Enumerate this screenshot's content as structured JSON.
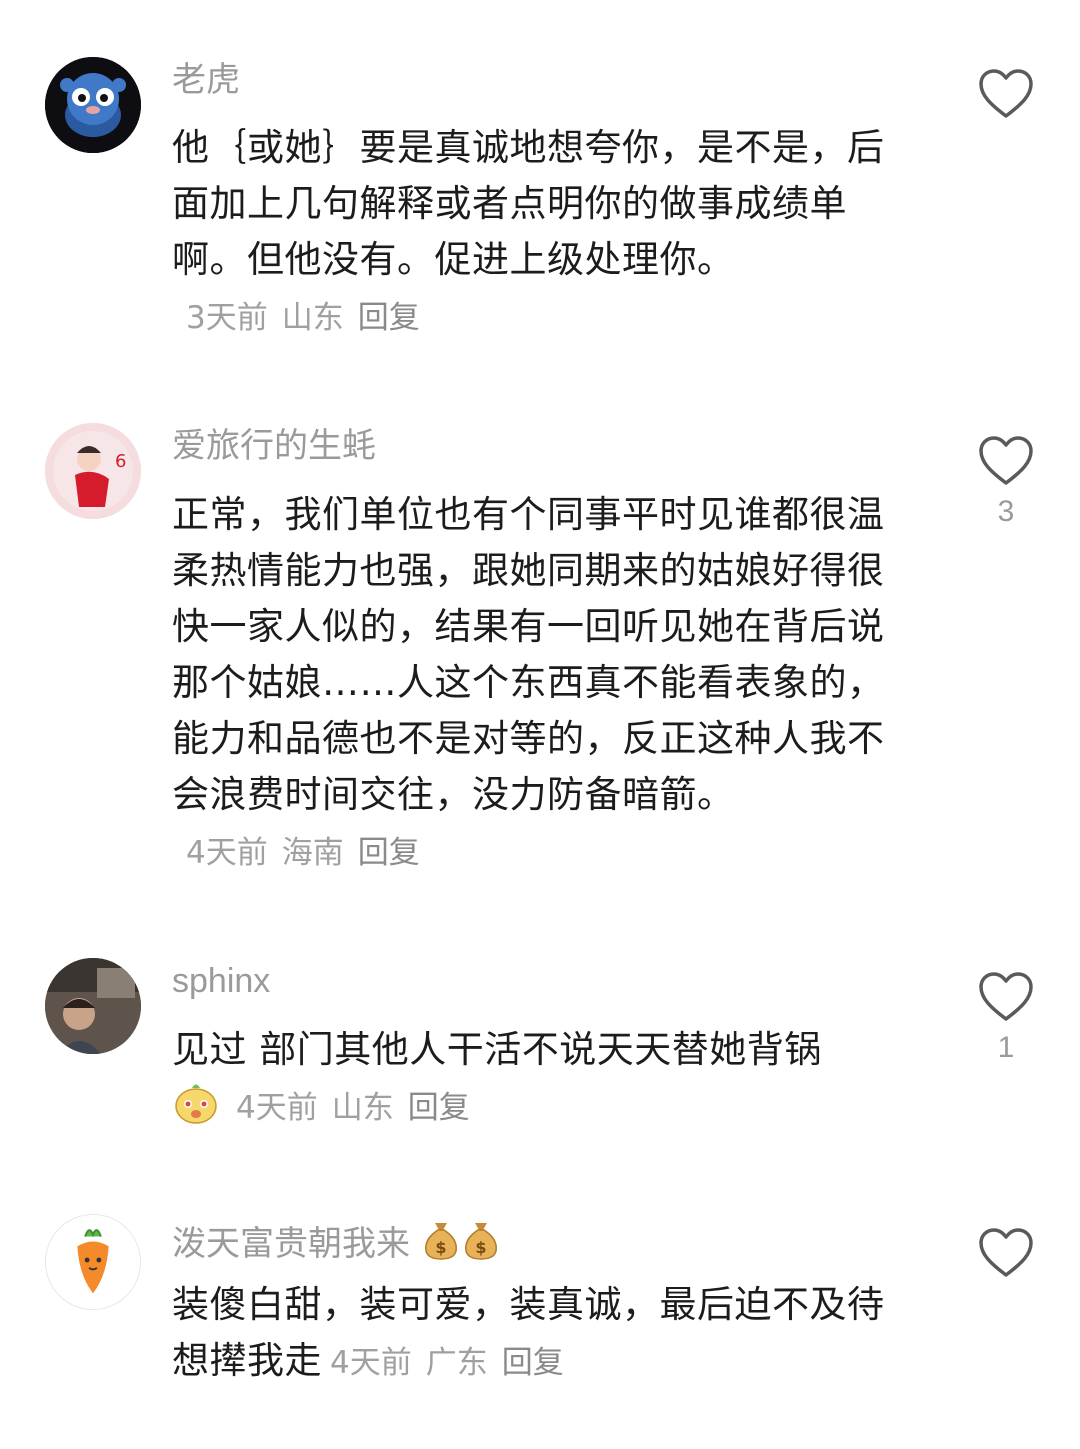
{
  "comments": [
    {
      "username": "老虎",
      "text": "他｛或她｝要是真诚地想夸你，是不是，后面加上几句解释或者点明你的做事成绩单啊。但他没有。促进上级处理你。",
      "time": "3天前",
      "location": "山东",
      "reply": "回复",
      "likes": ""
    },
    {
      "username": "爱旅行的生蚝",
      "text": "正常，我们单位也有个同事平时见谁都很温柔热情能力也强，跟她同期来的姑娘好得很快一家人似的，结果有一回听见她在背后说那个姑娘……人这个东西真不能看表象的，能力和品德也不是对等的，反正这种人我不会浪费时间交往，没力防备暗箭。",
      "time": "4天前",
      "location": "海南",
      "reply": "回复",
      "likes": "3"
    },
    {
      "username": "sphinx",
      "text": "见过 部门其他人干活不说天天替她背锅",
      "time": "4天前",
      "location": "山东",
      "reply": "回复",
      "likes": "1"
    },
    {
      "username": "泼天富贵朝我来",
      "text": "装傻白甜，装可爱，装真诚，最后迫不及待想撵我走",
      "time": "4天前",
      "location": "广东",
      "reply": "回复",
      "likes": ""
    }
  ]
}
